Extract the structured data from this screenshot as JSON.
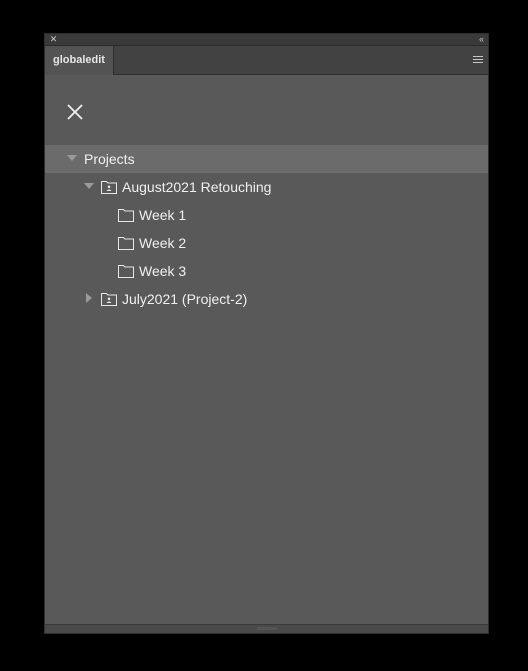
{
  "panel": {
    "tab_label": "globaledit"
  },
  "tree": {
    "root": {
      "label": "Projects",
      "expanded": true,
      "selected": true
    },
    "projects": [
      {
        "label": "August2021 Retouching",
        "expanded": true,
        "folders": [
          {
            "label": "Week 1"
          },
          {
            "label": "Week 2"
          },
          {
            "label": "Week 3"
          }
        ]
      },
      {
        "label": "July2021 (Project-2)",
        "expanded": false
      }
    ]
  },
  "icons": {
    "panel_close": "close-icon",
    "collapse": "double-chevron-left-icon",
    "panel_menu": "hamburger-menu-icon",
    "dismiss": "close-icon",
    "project_folder": "shared-folder-icon",
    "folder": "folder-icon"
  },
  "colors": {
    "background": "#000000",
    "panel": "#595959",
    "selected_row": "#6b6b6b",
    "text": "#f0f0f0"
  }
}
